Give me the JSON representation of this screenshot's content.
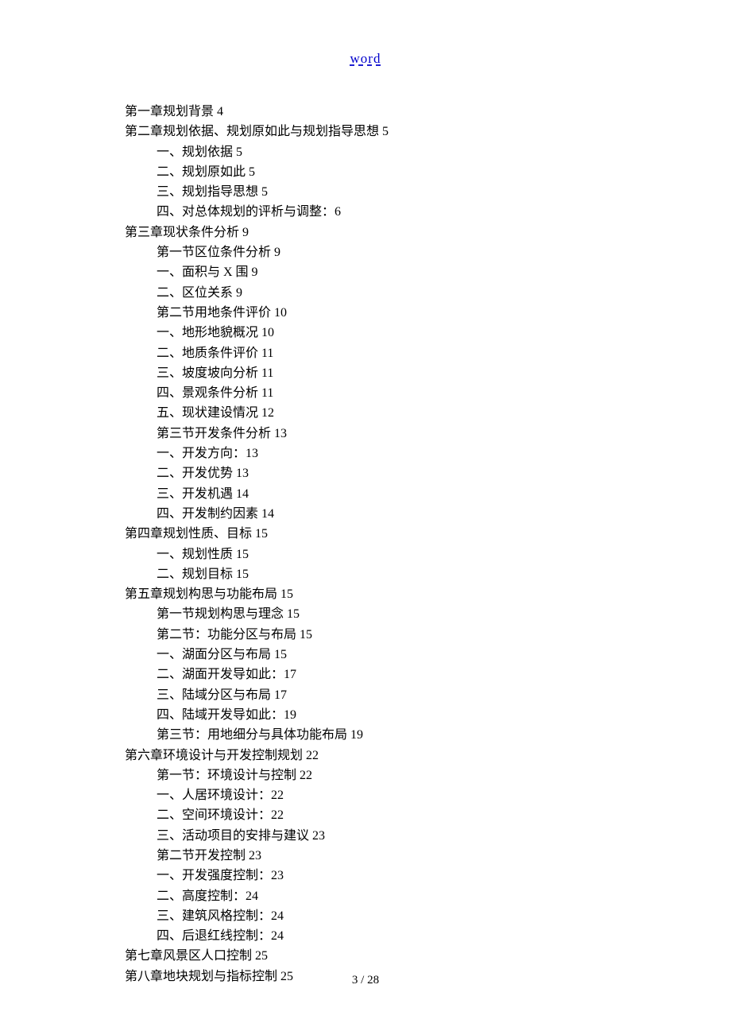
{
  "header": {
    "link_text": "word"
  },
  "toc": [
    {
      "level": 0,
      "text": "第一章规划背景 4"
    },
    {
      "level": 0,
      "text": "第二章规划依据、规划原如此与规划指导思想 5"
    },
    {
      "level": 1,
      "text": "一、规划依据 5"
    },
    {
      "level": 1,
      "text": "二、规划原如此 5"
    },
    {
      "level": 1,
      "text": "三、规划指导思想 5"
    },
    {
      "level": 1,
      "text": "四、对总体规划的评析与调整：6"
    },
    {
      "level": 0,
      "text": "第三章现状条件分析 9"
    },
    {
      "level": 1,
      "text": "第一节区位条件分析 9"
    },
    {
      "level": 1,
      "text": "一、面积与 X 围 9"
    },
    {
      "level": 1,
      "text": "二、区位关系 9"
    },
    {
      "level": 1,
      "text": "第二节用地条件评价 10"
    },
    {
      "level": 1,
      "text": "一、地形地貌概况 10"
    },
    {
      "level": 1,
      "text": "二、地质条件评价 11"
    },
    {
      "level": 1,
      "text": "三、坡度坡向分析 11"
    },
    {
      "level": 1,
      "text": "四、景观条件分析 11"
    },
    {
      "level": 1,
      "text": "五、现状建设情况 12"
    },
    {
      "level": 1,
      "text": "第三节开发条件分析 13"
    },
    {
      "level": 1,
      "text": "一、开发方向：13"
    },
    {
      "level": 1,
      "text": "二、开发优势 13"
    },
    {
      "level": 1,
      "text": "三、开发机遇 14"
    },
    {
      "level": 1,
      "text": "四、开发制约因素 14"
    },
    {
      "level": 0,
      "text": "第四章规划性质、目标 15"
    },
    {
      "level": 1,
      "text": "一、规划性质 15"
    },
    {
      "level": 1,
      "text": "二、规划目标 15"
    },
    {
      "level": 0,
      "text": "第五章规划构思与功能布局 15"
    },
    {
      "level": 1,
      "text": "第一节规划构思与理念 15"
    },
    {
      "level": 1,
      "text": "第二节：功能分区与布局 15"
    },
    {
      "level": 1,
      "text": "一、湖面分区与布局 15"
    },
    {
      "level": 1,
      "text": "二、湖面开发导如此：17"
    },
    {
      "level": 1,
      "text": "三、陆域分区与布局 17"
    },
    {
      "level": 1,
      "text": "四、陆域开发导如此：19"
    },
    {
      "level": 1,
      "text": "第三节：用地细分与具体功能布局 19"
    },
    {
      "level": 0,
      "text": "第六章环境设计与开发控制规划 22"
    },
    {
      "level": 1,
      "text": "第一节：环境设计与控制 22"
    },
    {
      "level": 1,
      "text": "一、人居环境设计：22"
    },
    {
      "level": 1,
      "text": "二、空间环境设计：22"
    },
    {
      "level": 1,
      "text": "三、活动项目的安排与建议 23"
    },
    {
      "level": 1,
      "text": "第二节开发控制 23"
    },
    {
      "level": 1,
      "text": "一、开发强度控制：23"
    },
    {
      "level": 1,
      "text": "二、高度控制：24"
    },
    {
      "level": 1,
      "text": "三、建筑风格控制：24"
    },
    {
      "level": 1,
      "text": "四、后退红线控制：24"
    },
    {
      "level": 0,
      "text": "第七章风景区人口控制 25"
    },
    {
      "level": 0,
      "text": "第八章地块规划与指标控制 25"
    }
  ],
  "footer": {
    "page_label": "3 / 28"
  }
}
